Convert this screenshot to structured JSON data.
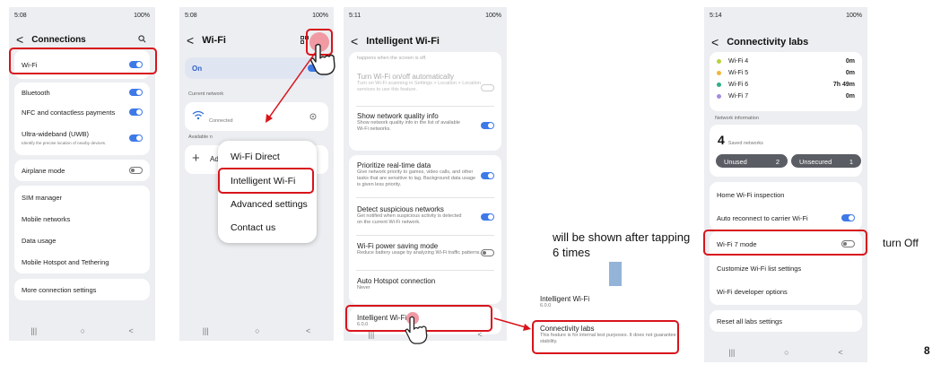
{
  "phone1": {
    "status": {
      "time": "5:08",
      "right": "100%"
    },
    "title": "Connections",
    "back_glyph": "<",
    "items": [
      {
        "label": "Wi-Fi",
        "toggle": "on"
      },
      {
        "label": "Bluetooth",
        "toggle": "on"
      },
      {
        "label": "NFC and contactless payments",
        "toggle": "on"
      },
      {
        "label": "Ultra-wideband (UWB)",
        "sub": "Identify the precise location of nearby devices.",
        "toggle": "on"
      },
      {
        "label": "Airplane mode",
        "toggle": "off"
      },
      {
        "label": "SIM manager"
      },
      {
        "label": "Mobile networks"
      },
      {
        "label": "Data usage"
      },
      {
        "label": "Mobile Hotspot and Tethering"
      },
      {
        "label": "More connection settings"
      }
    ]
  },
  "phone2": {
    "status": {
      "time": "5:08",
      "right": "100%"
    },
    "title": "Wi-Fi",
    "on_label": "On",
    "current_network_header": "Current network",
    "connected_label": "Connected",
    "available_header": "Available n",
    "add_label": "Ad",
    "menu": [
      "Wi-Fi Direct",
      "Intelligent Wi-Fi",
      "Advanced settings",
      "Contact us"
    ]
  },
  "phone3": {
    "status": {
      "time": "5:11",
      "right": "100%"
    },
    "title": "Intelligent Wi-Fi",
    "clipped_top": "happens when the screen is off.",
    "items": [
      {
        "title": "Turn Wi-Fi on/off automatically",
        "desc": "Turn on Wi-Fi scanning in Settings > Location > Location services to use this feature.",
        "toggle": "disabled"
      },
      {
        "title": "Show network quality info",
        "desc": "Show network quality info in the list of available Wi-Fi networks.",
        "toggle": "on"
      },
      {
        "title": "Prioritize real-time data",
        "desc": "Give network priority to games, video calls, and other tasks that are sensitive to lag. Background data usage is given less priority.",
        "toggle": "on"
      },
      {
        "title": "Detect suspicious networks",
        "desc": "Get notified when suspicious activity is detected on the current Wi-Fi network.",
        "toggle": "on"
      },
      {
        "title": "Wi-Fi power saving mode",
        "desc": "Reduce battery usage by analyzing Wi-Fi traffic patterns.",
        "toggle": "off"
      },
      {
        "title": "Auto Hotspot connection",
        "desc": "Never"
      },
      {
        "title": "Intelligent Wi-Fi",
        "desc": "6.0.0"
      }
    ]
  },
  "phone4": {
    "items": [
      {
        "title": "Intelligent Wi-Fi",
        "desc": "6.0.0"
      },
      {
        "title": "Connectivity labs",
        "desc": "This feature is for internal test purposes. It does not guarantee stability."
      }
    ]
  },
  "phone5": {
    "status": {
      "time": "5:14",
      "right": "100%"
    },
    "title": "Connectivity labs",
    "wifi_usage": [
      {
        "label": "Wi-Fi 4",
        "value": "0m",
        "color": "#b5d33c"
      },
      {
        "label": "Wi-Fi 5",
        "value": "0m",
        "color": "#f0b73a"
      },
      {
        "label": "Wi-Fi 6",
        "value": "7h 49m",
        "color": "#2fae88"
      },
      {
        "label": "Wi-Fi 7",
        "value": "0m",
        "color": "#a48be0"
      }
    ],
    "network_info_header": "Network information",
    "saved_count": "4",
    "saved_label": "Saved networks",
    "unused_label": "Unused",
    "unused_count": "2",
    "unsecured_label": "Unsecured",
    "unsecured_count": "1",
    "items": [
      {
        "label": "Home Wi-Fi inspection"
      },
      {
        "label": "Auto reconnect to carrier Wi-Fi",
        "toggle": "on"
      },
      {
        "label": "Wi-Fi 7 mode",
        "toggle": "off"
      },
      {
        "label": "Customize Wi-Fi list settings"
      },
      {
        "label": "Wi-Fi developer options"
      },
      {
        "label": "Reset all labs settings"
      }
    ]
  },
  "annotations": {
    "note": "will be shown after tapping 6 times",
    "turn_off": "turn Off",
    "page_number": "8"
  },
  "navbar": {
    "recent": "|||",
    "home": "○",
    "back": "<"
  },
  "colors": {
    "accent": "#3e79e8",
    "highlight": "#d8141b",
    "arrow": "#94b3d9"
  }
}
